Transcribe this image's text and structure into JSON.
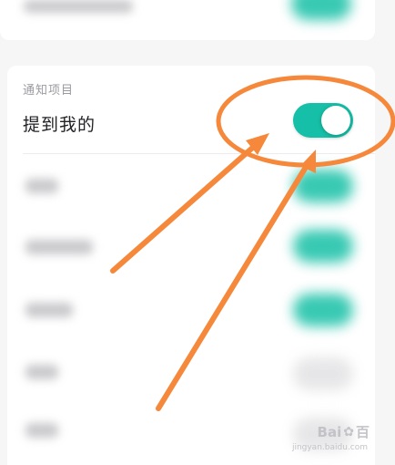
{
  "settings": {
    "section_label": "通知项目",
    "mention_me": {
      "label": "提到我的",
      "enabled": true
    }
  },
  "colors": {
    "toggle_on": "#16bfa7",
    "annotation": "#f5883a"
  },
  "icons": {
    "annotation_arrows": "arrow-icon",
    "annotation_circle": "ellipse-highlight"
  },
  "watermark": {
    "brand": "Bai",
    "brand_suffix": "百",
    "sub": "jingyan.baidu.com"
  }
}
